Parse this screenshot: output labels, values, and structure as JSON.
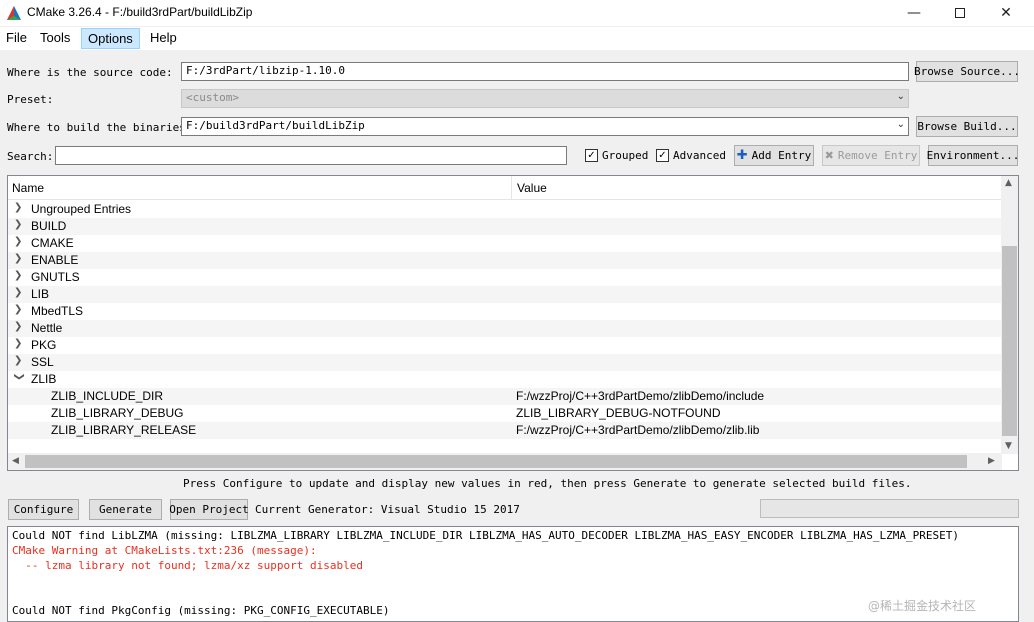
{
  "window": {
    "title": "CMake 3.26.4 - F:/build3rdPart/buildLibZip",
    "minimize_icon": "minimize-icon",
    "maximize_icon": "maximize-icon",
    "close_icon": "close-icon"
  },
  "menu": {
    "items": [
      {
        "label": "File"
      },
      {
        "label": "Tools"
      },
      {
        "label": "Options",
        "active": true
      },
      {
        "label": "Help"
      }
    ]
  },
  "source": {
    "label": "Where is the source code:",
    "value": "F:/3rdPart/libzip-1.10.0",
    "browse_label": "Browse Source..."
  },
  "preset": {
    "label": "Preset:",
    "value": "<custom>"
  },
  "build": {
    "label": "Where to build the binaries:",
    "value": "F:/build3rdPart/buildLibZip",
    "browse_label": "Browse Build..."
  },
  "search": {
    "label": "Search:",
    "value": "",
    "grouped_label": "Grouped",
    "grouped_checked": true,
    "advanced_label": "Advanced",
    "advanced_checked": true,
    "add_entry_label": "Add Entry",
    "remove_entry_label": "Remove Entry",
    "environment_label": "Environment..."
  },
  "tree": {
    "col_name": "Name",
    "col_value": "Value",
    "groups": [
      {
        "name": "Ungrouped Entries",
        "expanded": false
      },
      {
        "name": "BUILD",
        "expanded": false
      },
      {
        "name": "CMAKE",
        "expanded": false
      },
      {
        "name": "ENABLE",
        "expanded": false
      },
      {
        "name": "GNUTLS",
        "expanded": false
      },
      {
        "name": "LIB",
        "expanded": false
      },
      {
        "name": "MbedTLS",
        "expanded": false
      },
      {
        "name": "Nettle",
        "expanded": false
      },
      {
        "name": "PKG",
        "expanded": false
      },
      {
        "name": "SSL",
        "expanded": false
      },
      {
        "name": "ZLIB",
        "expanded": true
      }
    ],
    "zlib_entries": [
      {
        "name": "ZLIB_INCLUDE_DIR",
        "value": "F:/wzzProj/C++3rdPartDemo/zlibDemo/include"
      },
      {
        "name": "ZLIB_LIBRARY_DEBUG",
        "value": "ZLIB_LIBRARY_DEBUG-NOTFOUND"
      },
      {
        "name": "ZLIB_LIBRARY_RELEASE",
        "value": "F:/wzzProj/C++3rdPartDemo/zlibDemo/zlib.lib"
      }
    ]
  },
  "hint": "Press Configure to update and display new values in red, then press Generate to generate selected build files.",
  "actions": {
    "configure_label": "Configure",
    "generate_label": "Generate",
    "open_project_label": "Open Project",
    "generator_text": "Current Generator: Visual Studio 15 2017"
  },
  "log": {
    "lines": [
      {
        "text": "Could NOT find LibLZMA (missing: LIBLZMA_LIBRARY LIBLZMA_INCLUDE_DIR LIBLZMA_HAS_AUTO_DECODER LIBLZMA_HAS_EASY_ENCODER LIBLZMA_HAS_LZMA_PRESET)",
        "color": "#000000"
      },
      {
        "text": "CMake Warning at CMakeLists.txt:236 (message):",
        "color": "#e8301f"
      },
      {
        "text": "  -- lzma library not found; lzma/xz support disabled",
        "color": "#e8301f"
      },
      {
        "text": "",
        "color": "#000000"
      },
      {
        "text": "",
        "color": "#000000"
      },
      {
        "text": "Could NOT find PkgConfig (missing: PKG_CONFIG_EXECUTABLE)",
        "color": "#000000"
      }
    ]
  },
  "watermark": "@稀土掘金技术社区",
  "colors": {
    "accent": "#0078d7",
    "warning": "#e8301f",
    "menu_active": "#cce8ff"
  }
}
